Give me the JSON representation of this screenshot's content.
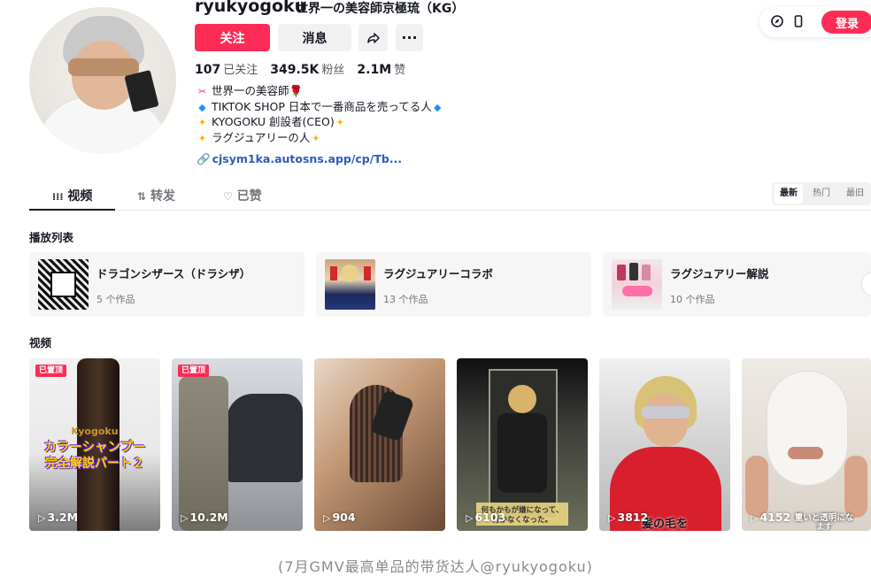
{
  "profile": {
    "username": "ryukyogoku",
    "nickname": "世界一の美容師京極琉（KG）",
    "follow_label": "关注",
    "message_label": "消息",
    "stats": [
      {
        "value": "107",
        "label": "已关注"
      },
      {
        "value": "349.5K",
        "label": "粉丝"
      },
      {
        "value": "2.1M",
        "label": "赞"
      }
    ],
    "bio": [
      {
        "icon": "✂",
        "text": "世界一の美容師"
      },
      {
        "icon": "◆",
        "text": "TIKTOK SHOP 日本で一番商品を売ってる人"
      },
      {
        "icon": "✦",
        "text": "KYOGOKU 創設者(CEO)"
      },
      {
        "icon": "✦",
        "text": "ラグジュアリーの人"
      }
    ],
    "bio_suffix": [
      "🌹",
      "◆",
      "✦",
      "✦"
    ],
    "link": "cjsym1ka.autosns.app/cp/Tb..."
  },
  "topbar": {
    "login_label": "登录"
  },
  "tabs": [
    {
      "label": "视频",
      "icon": "grid-icon",
      "glyph": "⁞⁞⁞"
    },
    {
      "label": "转发",
      "icon": "repost-icon",
      "glyph": "⇅"
    },
    {
      "label": "已赞",
      "icon": "heart-icon",
      "glyph": "♡"
    }
  ],
  "sort": [
    "最新",
    "热门",
    "最旧"
  ],
  "playlist_section": "播放列表",
  "playlists": [
    {
      "name": "ドラゴンシザース（ドラシザ）",
      "count": "5 个作品"
    },
    {
      "name": "ラグジュアリーコラボ",
      "count": "13 个作品"
    },
    {
      "name": "ラグジュアリー解説",
      "count": "10 个作品"
    }
  ],
  "video_section": "视频",
  "videos": [
    {
      "views": "3.2M",
      "pinned": "已置顶",
      "overlay": [
        "Kyogoku",
        "カラーシャンプー",
        "完全解説パート２"
      ]
    },
    {
      "views": "10.2M",
      "pinned": "已置顶"
    },
    {
      "views": "904"
    },
    {
      "views": "6103",
      "overlay": [
        "何もかもが嫌になって、",
        "行かなくなった。"
      ]
    },
    {
      "views": "3812",
      "overlay": [
        "髪の毛を"
      ]
    },
    {
      "views": "4152",
      "overlay": [
        "重いと透明にな",
        "ます"
      ]
    }
  ],
  "caption": "(7月GMV最高单品的带货达人@ryukyogoku)",
  "colors": {
    "accent": "#fe2c55",
    "link": "#2b5db9",
    "text": "#161823",
    "muted": "#73747b"
  }
}
